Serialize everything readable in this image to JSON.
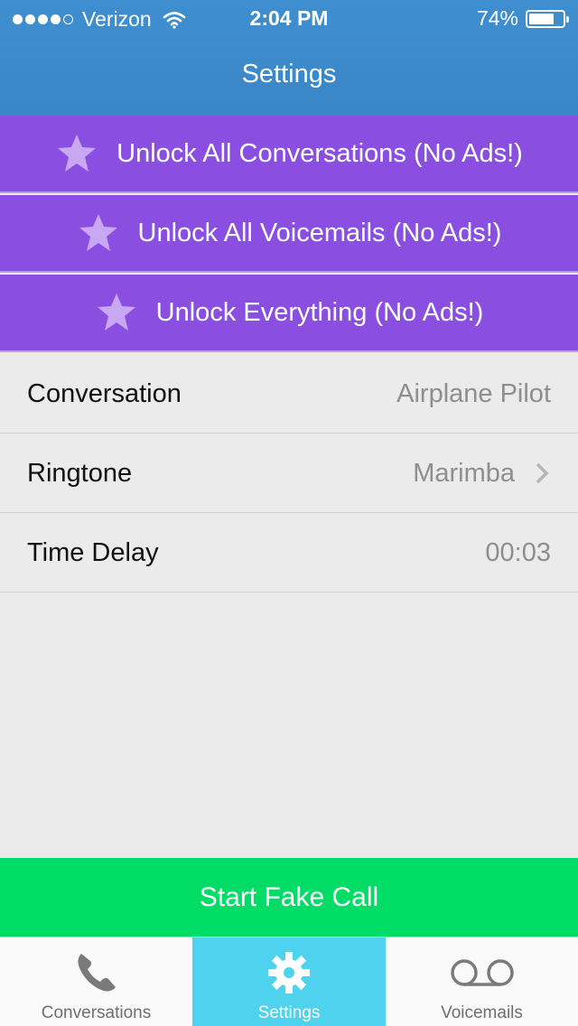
{
  "status": {
    "carrier": "Verizon",
    "time": "2:04 PM",
    "battery": "74%",
    "battery_fraction": 0.74,
    "signal_bars_filled": 4,
    "signal_bars_total": 5
  },
  "nav": {
    "title": "Settings"
  },
  "unlock": [
    {
      "label": "Unlock All Conversations (No Ads!)",
      "icon": "star-icon"
    },
    {
      "label": "Unlock All Voicemails (No Ads!)",
      "icon": "star-icon"
    },
    {
      "label": "Unlock Everything (No Ads!)",
      "icon": "star-icon"
    }
  ],
  "settings": [
    {
      "label": "Conversation",
      "value": "Airplane Pilot"
    },
    {
      "label": "Ringtone",
      "value": "Marimba"
    },
    {
      "label": "Time Delay",
      "value": "00:03"
    }
  ],
  "start_button": "Start Fake Call",
  "tabs": [
    {
      "label": "Conversations",
      "icon": "phone-icon"
    },
    {
      "label": "Settings",
      "icon": "gear-icon",
      "active": true
    },
    {
      "label": "Voicemails",
      "icon": "voicemail-icon"
    }
  ],
  "colors": {
    "header": "#3a86c6",
    "unlock_bg": "#8a4fe0",
    "start_bg": "#00dc66",
    "active_tab": "#4ed2ee"
  }
}
